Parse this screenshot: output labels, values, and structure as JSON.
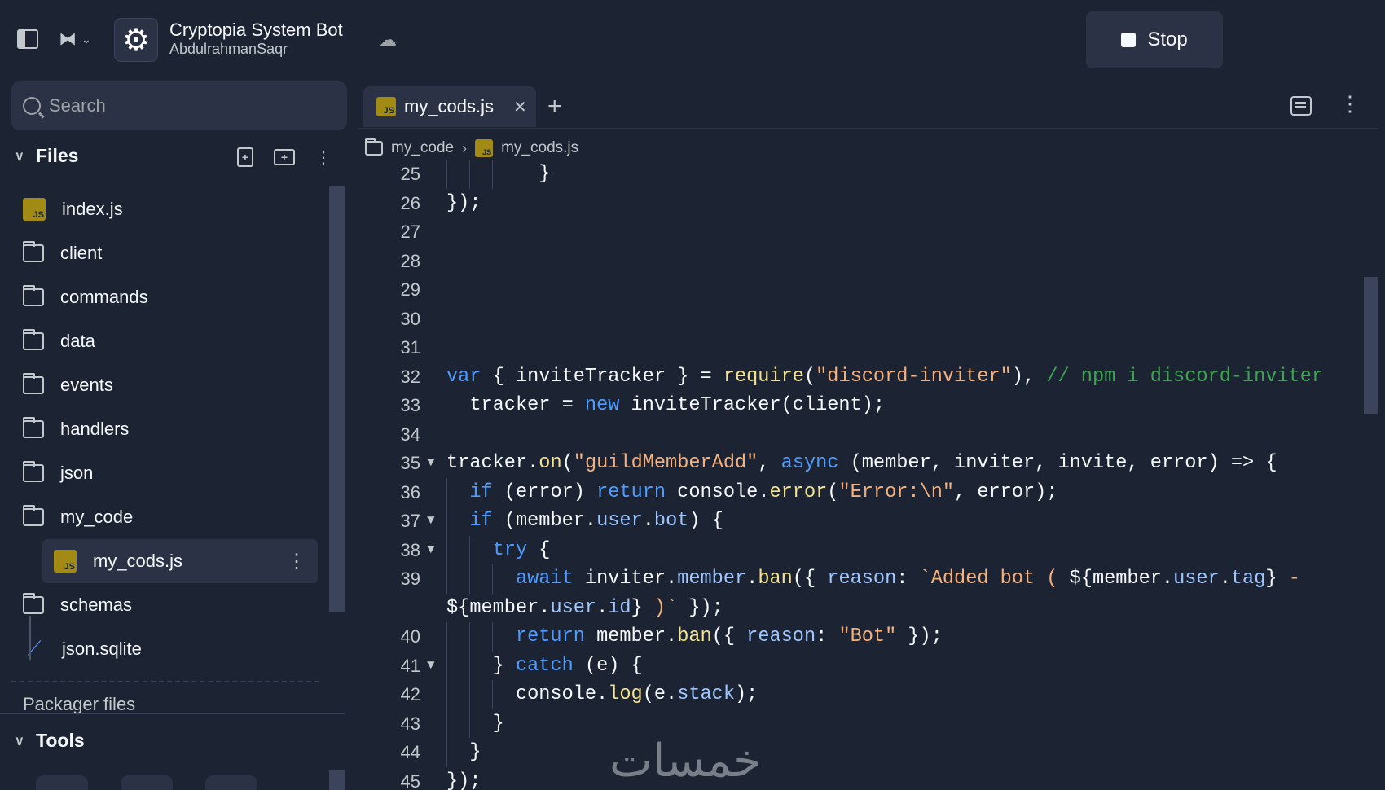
{
  "header": {
    "repl_title": "Cryptopia System Bot",
    "repl_owner": "AbdulrahmanSaqr",
    "stop_label": "Stop"
  },
  "sidebar": {
    "search_placeholder": "Search",
    "files_title": "Files",
    "items": [
      {
        "label": "index.js",
        "icon": "js-file-icon"
      },
      {
        "label": "client",
        "icon": "folder-icon"
      },
      {
        "label": "commands",
        "icon": "folder-icon"
      },
      {
        "label": "data",
        "icon": "folder-icon"
      },
      {
        "label": "events",
        "icon": "folder-icon"
      },
      {
        "label": "handlers",
        "icon": "folder-icon"
      },
      {
        "label": "json",
        "icon": "folder-icon"
      },
      {
        "label": "my_code",
        "icon": "folder-open-icon"
      },
      {
        "label": "my_cods.js",
        "icon": "js-file-icon"
      },
      {
        "label": "schemas",
        "icon": "folder-icon"
      },
      {
        "label": "json.sqlite",
        "icon": "sqlite-feather-icon"
      }
    ],
    "packager_label": "Packager files",
    "tools_title": "Tools"
  },
  "editor": {
    "tab_label": "my_cods.js",
    "breadcrumb": [
      "my_code",
      "my_cods.js"
    ],
    "line_numbers": [
      "25",
      "26",
      "27",
      "28",
      "29",
      "30",
      "31",
      "32",
      "33",
      "34",
      "35",
      "36",
      "37",
      "38",
      "39",
      "",
      "40",
      "41",
      "42",
      "43",
      "44",
      "45"
    ]
  },
  "watermark": "خمسات",
  "colors": {
    "background": "#1c2333",
    "surface": "#2b3245",
    "keyword": "#4f9cff",
    "function": "#f2e291",
    "string": "#f5b07c",
    "comment": "#3ea452"
  }
}
